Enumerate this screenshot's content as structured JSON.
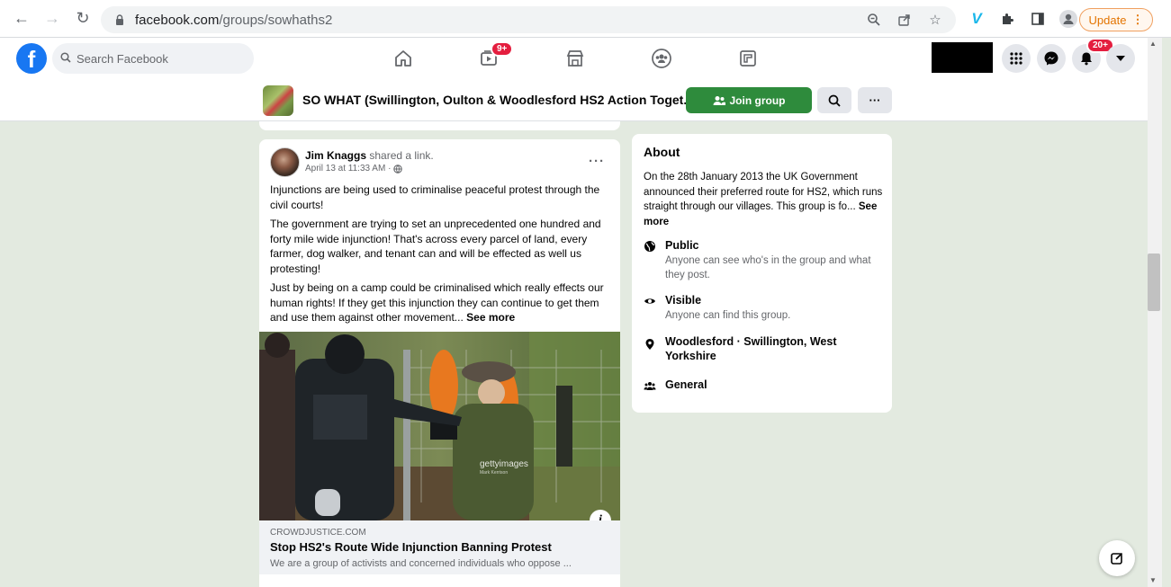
{
  "browser": {
    "url_domain": "facebook.com",
    "url_path": "/groups/sowhaths2",
    "update_label": "Update",
    "update_menu": "⋮"
  },
  "fb": {
    "search_placeholder": "Search Facebook",
    "watch_badge": "9+",
    "notif_badge": "20+",
    "brand_color": "#1877f2"
  },
  "group": {
    "name": "SO WHAT (Swillington, Oulton & Woodlesford HS2 Action Toget...",
    "join_label": "Join group",
    "more_label": "···"
  },
  "post": {
    "author": "Jim Knaggs",
    "action": "shared a link.",
    "timestamp": "April 13 at 11:33 AM ·",
    "more": "···",
    "paragraphs": [
      "Injunctions are being used to criminalise peaceful protest through the civil courts!",
      "The government are trying to set an unprecedented one hundred and forty mile wide injunction! That's across every parcel of land, every farmer, dog walker, and tenant can and will be effected as well us protesting!",
      "Just by being on a camp could be criminalised which really effects our human rights! If they get this injunction they can continue to get them and use them against other movement..."
    ],
    "see_more": "See more",
    "image_watermark": "gettyimages",
    "image_credit": "Mark Kerrison",
    "info": "i",
    "link_domain": "CROWDJUSTICE.COM",
    "link_title": "Stop HS2's Route Wide Injunction Banning Protest",
    "link_desc": "We are a group of activists and concerned individuals who oppose ..."
  },
  "about": {
    "title": "About",
    "description": "On the 28th January 2013 the UK Government announced their preferred route for HS2, which runs straight through our villages. This group is fo...",
    "see_more": "See more",
    "privacy_title": "Public",
    "privacy_sub": "Anyone can see who's in the group and what they post.",
    "visibility_title": "Visible",
    "visibility_sub": "Anyone can find this group.",
    "location": "Woodlesford · Swillington, West Yorkshire",
    "category": "General"
  }
}
